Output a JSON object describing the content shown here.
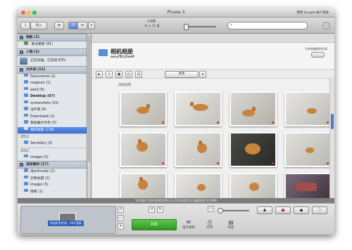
{
  "window": {
    "title": "Picasa 3",
    "signin_link": "使用 Google 帐户登录"
  },
  "toolbar": {
    "import_label": "导入",
    "filter_label": "过滤器",
    "search_placeholder": ""
  },
  "sidebar": {
    "groups": {
      "albums": "相册 (1)",
      "people": "人物 (1)",
      "folders": "文件夹 (11)",
      "special": "其他素材 (17)"
    },
    "album_items": [
      "单点更新 (81)"
    ],
    "people_items": [
      "正在扫描，已完成 83%"
    ],
    "folder_items": [
      {
        "label": "Documents (1)",
        "bold": false,
        "selected": false
      },
      {
        "label": "magican (1)",
        "bold": false,
        "selected": false
      },
      {
        "label": "exe3 (9)",
        "bold": false,
        "selected": false
      },
      {
        "label": "Desktop (67)",
        "bold": true,
        "selected": false
      },
      {
        "label": "screenshots (15)",
        "bold": false,
        "selected": false
      },
      {
        "label": "证件照 (6)",
        "bold": false,
        "selected": false
      },
      {
        "label": "Downloads (2)",
        "bold": false,
        "selected": false
      },
      {
        "label": "我发展文件夹 (3)",
        "bold": false,
        "selected": false
      },
      {
        "label": "相机相册 (118)",
        "bold": false,
        "selected": true
      }
    ],
    "year_2012": "2012",
    "folder_items_2012": [
      "Secretary (3)"
    ],
    "year_2011": "2011",
    "folder_items_2011": [
      "images (5)"
    ],
    "special_items": [
      "djsslinuzby (2)",
      "云像加盟 (1)",
      "images (5)",
      "情照 (1)"
    ]
  },
  "main": {
    "album_title": "相机相册",
    "album_subtitle": "aocy专心Xaofl",
    "share_label": "与共他者即时分享",
    "share_button_label": "共享",
    "section_label": "添加说明"
  },
  "status": {
    "text": "118 图片   2013年8月29日 至 2013年8月5日   磁盘空间 25.4MB"
  },
  "bottom": {
    "tray_label": "所选的文件夹，118 张照",
    "share_button": "共享",
    "email_label": "电子邮件",
    "print_label": "打印",
    "export_label": "导出"
  },
  "colors": {
    "selection": "#3b6fd0",
    "accent_green": "#2f9a22",
    "folder_blue": "#5b8fd1"
  }
}
